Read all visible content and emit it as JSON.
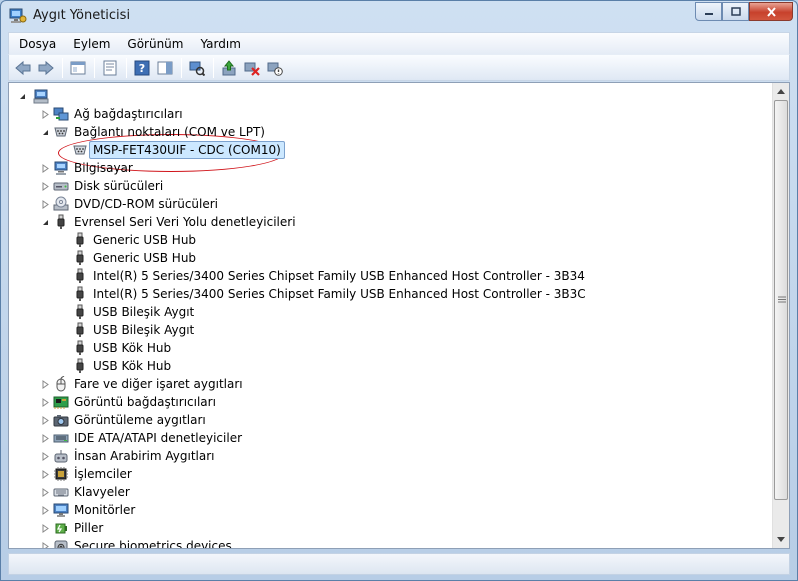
{
  "window": {
    "title": "Aygıt Yöneticisi"
  },
  "menu": [
    "Dosya",
    "Eylem",
    "Görünüm",
    "Yardım"
  ],
  "tree": {
    "root_icon": "computer-icon",
    "items": [
      {
        "label": "Ağ bağdaştırıcıları",
        "level": 1,
        "expander": "collapsed",
        "icon": "network-adapter-icon"
      },
      {
        "label": "Bağlantı noktaları (COM ve LPT)",
        "level": 1,
        "expander": "expanded",
        "icon": "port-icon"
      },
      {
        "label": "MSP-FET430UIF - CDC (COM10)",
        "level": 2,
        "expander": "none",
        "icon": "port-device-icon",
        "selected": true
      },
      {
        "label": "Bilgisayar",
        "level": 1,
        "expander": "collapsed",
        "icon": "computer-icon"
      },
      {
        "label": "Disk sürücüleri",
        "level": 1,
        "expander": "collapsed",
        "icon": "disk-drive-icon"
      },
      {
        "label": "DVD/CD-ROM sürücüleri",
        "level": 1,
        "expander": "collapsed",
        "icon": "dvd-drive-icon"
      },
      {
        "label": "Evrensel Seri Veri Yolu denetleyicileri",
        "level": 1,
        "expander": "expanded",
        "icon": "usb-icon"
      },
      {
        "label": "Generic USB Hub",
        "level": 2,
        "expander": "none",
        "icon": "usb-icon"
      },
      {
        "label": "Generic USB Hub",
        "level": 2,
        "expander": "none",
        "icon": "usb-icon"
      },
      {
        "label": "Intel(R) 5 Series/3400 Series Chipset Family USB Enhanced Host Controller - 3B34",
        "level": 2,
        "expander": "none",
        "icon": "usb-icon"
      },
      {
        "label": "Intel(R) 5 Series/3400 Series Chipset Family USB Enhanced Host Controller - 3B3C",
        "level": 2,
        "expander": "none",
        "icon": "usb-icon"
      },
      {
        "label": "USB Bileşik Aygıt",
        "level": 2,
        "expander": "none",
        "icon": "usb-icon"
      },
      {
        "label": "USB Bileşik Aygıt",
        "level": 2,
        "expander": "none",
        "icon": "usb-icon"
      },
      {
        "label": "USB Kök Hub",
        "level": 2,
        "expander": "none",
        "icon": "usb-icon"
      },
      {
        "label": "USB Kök Hub",
        "level": 2,
        "expander": "none",
        "icon": "usb-icon"
      },
      {
        "label": "Fare ve diğer işaret aygıtları",
        "level": 1,
        "expander": "collapsed",
        "icon": "mouse-icon"
      },
      {
        "label": "Görüntü bağdaştırıcıları",
        "level": 1,
        "expander": "collapsed",
        "icon": "display-adapter-icon"
      },
      {
        "label": "Görüntüleme aygıtları",
        "level": 1,
        "expander": "collapsed",
        "icon": "imaging-device-icon"
      },
      {
        "label": "IDE ATA/ATAPI denetleyiciler",
        "level": 1,
        "expander": "collapsed",
        "icon": "ide-controller-icon"
      },
      {
        "label": "İnsan Arabirim Aygıtları",
        "level": 1,
        "expander": "collapsed",
        "icon": "hid-icon"
      },
      {
        "label": "İşlemciler",
        "level": 1,
        "expander": "collapsed",
        "icon": "processor-icon"
      },
      {
        "label": "Klavyeler",
        "level": 1,
        "expander": "collapsed",
        "icon": "keyboard-icon"
      },
      {
        "label": "Monitörler",
        "level": 1,
        "expander": "collapsed",
        "icon": "monitor-icon"
      },
      {
        "label": "Piller",
        "level": 1,
        "expander": "collapsed",
        "icon": "battery-icon"
      },
      {
        "label": "Secure biometrics devices",
        "level": 1,
        "expander": "collapsed",
        "icon": "biometric-icon"
      }
    ]
  },
  "colors": {
    "selection": "#cce8ff",
    "annotation": "#d0141a",
    "accent": "#1f5ea8"
  }
}
